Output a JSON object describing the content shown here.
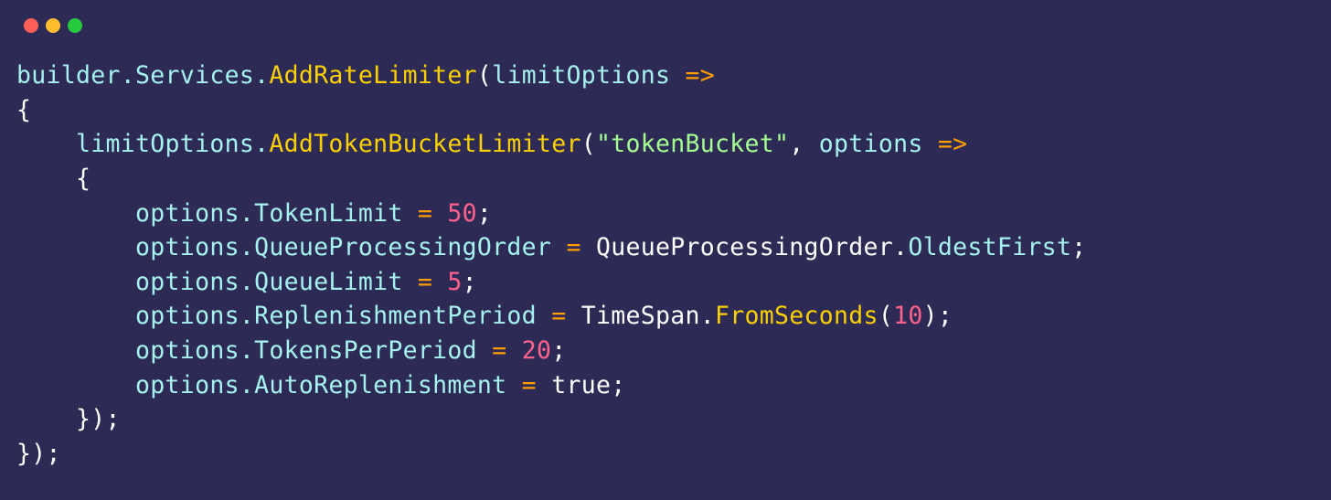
{
  "colors": {
    "background": "#2d2b55",
    "default": "#a5f2ef",
    "keyword": "#fad000",
    "identifier": "#ffffff",
    "property": "#a5f2ef",
    "operator": "#ff9d00",
    "string": "#a5ff90",
    "number": "#ff628c",
    "class": "#9effff",
    "punctuation": "#b0b0b0"
  },
  "code": {
    "line1": {
      "t1": "builder",
      "t2": ".",
      "t3": "Services",
      "t4": ".",
      "t5": "AddRateLimiter",
      "t6": "(",
      "t7": "limitOptions",
      "t8": " =>"
    },
    "line2": {
      "t1": "{"
    },
    "line3": {
      "indent": "    ",
      "t1": "limitOptions",
      "t2": ".",
      "t3": "AddTokenBucketLimiter",
      "t4": "(",
      "t5": "\"tokenBucket\"",
      "t6": ", ",
      "t7": "options",
      "t8": " =>"
    },
    "line4": {
      "indent": "    ",
      "t1": "{"
    },
    "line5": {
      "indent": "        ",
      "t1": "options",
      "t2": ".",
      "t3": "TokenLimit",
      "t4": " = ",
      "t5": "50",
      "t6": ";"
    },
    "line6": {
      "indent": "        ",
      "t1": "options",
      "t2": ".",
      "t3": "QueueProcessingOrder",
      "t4": " = ",
      "t5": "QueueProcessingOrder",
      "t6": ".",
      "t7": "OldestFirst",
      "t8": ";"
    },
    "line7": {
      "indent": "        ",
      "t1": "options",
      "t2": ".",
      "t3": "QueueLimit",
      "t4": " = ",
      "t5": "5",
      "t6": ";"
    },
    "line8": {
      "indent": "        ",
      "t1": "options",
      "t2": ".",
      "t3": "ReplenishmentPeriod",
      "t4": " = ",
      "t5": "TimeSpan",
      "t6": ".",
      "t7": "FromSeconds",
      "t8": "(",
      "t9": "10",
      "t10": ")",
      "t11": ";"
    },
    "line9": {
      "indent": "        ",
      "t1": "options",
      "t2": ".",
      "t3": "TokensPerPeriod",
      "t4": " = ",
      "t5": "20",
      "t6": ";"
    },
    "line10": {
      "indent": "        ",
      "t1": "options",
      "t2": ".",
      "t3": "AutoReplenishment",
      "t4": " = ",
      "t5": "true",
      "t6": ";"
    },
    "line11": {
      "indent": "    ",
      "t1": "});"
    },
    "line12": {
      "t1": "});"
    }
  }
}
